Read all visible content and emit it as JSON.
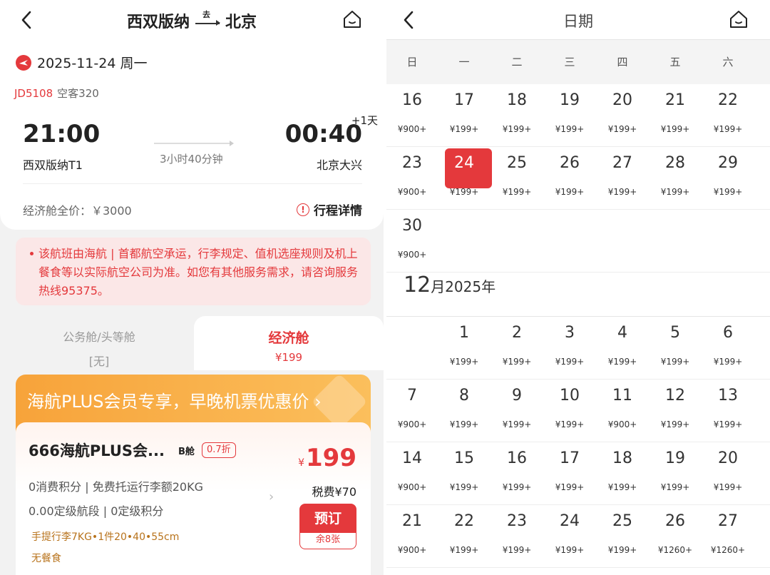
{
  "left": {
    "nav": {
      "origin": "西双版纳",
      "route_marker": "去",
      "destination": "北京"
    },
    "date": "2025-11-24 周一",
    "flight_no": "JD5108",
    "aircraft": "空客320",
    "dep_time": "21:00",
    "arr_time": "00:40",
    "plus_day": "+1天",
    "duration": "3小时40分钟",
    "dep_airport": "西双版纳T1",
    "arr_airport": "北京大兴",
    "full_price": "经济舱全价：￥3000",
    "trip_detail": "行程详情",
    "notice": "该航班由海航 | 首都航空承运，行李规定、值机选座规则及机上餐食等以实际航空公司为准。如您有其他服务需求，请咨询服务热线95375。",
    "tabs": {
      "business": {
        "label": "公务舱/头等舱",
        "sub": "[无]"
      },
      "economy": {
        "label": "经济舱",
        "sub": "¥199"
      }
    },
    "plus_banner": "海航PLUS会员专享，早晚机票优惠价 ›",
    "product": {
      "name": "666海航PLUS会...",
      "cabin": "B舱",
      "discount": "0.7折",
      "feature1": "0消费积分 | 免费托运行李额20KG",
      "feature2": "0.00定级航段 | 0定级积分",
      "baggage": "手提行李7KG•1件20•40•55cm",
      "meal": "无餐食",
      "price_yen": "¥",
      "price": "199",
      "tax": "税费¥70",
      "book": "预订",
      "remaining": "余8张"
    }
  },
  "right": {
    "title": "日期",
    "weekdays": [
      "日",
      "一",
      "二",
      "三",
      "四",
      "五",
      "六"
    ],
    "nov_weeks": [
      [
        [
          "16",
          "¥900+"
        ],
        [
          "17",
          "¥199+"
        ],
        [
          "18",
          "¥199+"
        ],
        [
          "19",
          "¥199+"
        ],
        [
          "20",
          "¥199+"
        ],
        [
          "21",
          "¥199+"
        ],
        [
          "22",
          "¥199+"
        ]
      ],
      [
        [
          "23",
          "¥900+"
        ],
        [
          "24",
          "¥199+"
        ],
        [
          "25",
          "¥199+"
        ],
        [
          "26",
          "¥199+"
        ],
        [
          "27",
          "¥199+"
        ],
        [
          "28",
          "¥199+"
        ],
        [
          "29",
          "¥199+"
        ]
      ],
      [
        [
          "30",
          "¥900+"
        ],
        [
          "",
          ""
        ],
        [
          "",
          ""
        ],
        [
          "",
          ""
        ],
        [
          "",
          ""
        ],
        [
          "",
          ""
        ],
        [
          "",
          ""
        ]
      ]
    ],
    "selected_day": "24",
    "dec_month_num": "12",
    "dec_month_suffix": "月2025年",
    "dec_weeks": [
      [
        [
          "",
          ""
        ],
        [
          "1",
          "¥199+"
        ],
        [
          "2",
          "¥199+"
        ],
        [
          "3",
          "¥199+"
        ],
        [
          "4",
          "¥199+"
        ],
        [
          "5",
          "¥199+"
        ],
        [
          "6",
          "¥199+"
        ]
      ],
      [
        [
          "7",
          "¥900+"
        ],
        [
          "8",
          "¥199+"
        ],
        [
          "9",
          "¥199+"
        ],
        [
          "10",
          "¥199+"
        ],
        [
          "11",
          "¥900+"
        ],
        [
          "12",
          "¥199+"
        ],
        [
          "13",
          "¥199+"
        ]
      ],
      [
        [
          "14",
          "¥900+"
        ],
        [
          "15",
          "¥199+"
        ],
        [
          "16",
          "¥199+"
        ],
        [
          "17",
          "¥199+"
        ],
        [
          "18",
          "¥199+"
        ],
        [
          "19",
          "¥199+"
        ],
        [
          "20",
          "¥199+"
        ]
      ],
      [
        [
          "21",
          "¥900+"
        ],
        [
          "22",
          "¥199+"
        ],
        [
          "23",
          "¥199+"
        ],
        [
          "24",
          "¥199+"
        ],
        [
          "25",
          "¥199+"
        ],
        [
          "26",
          "¥1260+"
        ],
        [
          "27",
          "¥1260+"
        ]
      ]
    ]
  },
  "colors": {
    "accent": "#e4393c",
    "orange": "#f7a33a"
  }
}
